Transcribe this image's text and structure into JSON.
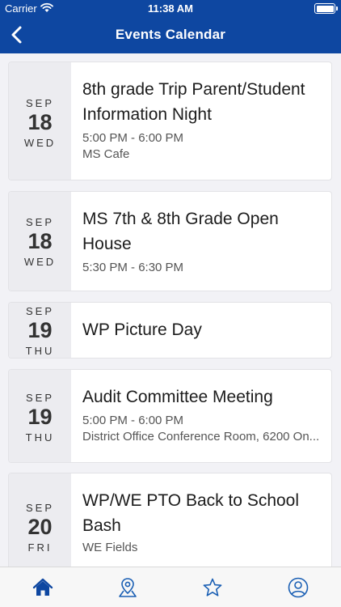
{
  "status": {
    "carrier": "Carrier",
    "time": "11:38 AM"
  },
  "header": {
    "title": "Events Calendar"
  },
  "events": [
    {
      "month": "SEP",
      "day": "18",
      "weekday": "WED",
      "title": "8th grade Trip Parent/Student Information Night",
      "time": "5:00 PM - 6:00 PM",
      "location": "MS Cafe"
    },
    {
      "month": "SEP",
      "day": "18",
      "weekday": "WED",
      "title": "MS 7th & 8th Grade Open House",
      "time": "5:30 PM - 6:30 PM",
      "location": ""
    },
    {
      "month": "SEP",
      "day": "19",
      "weekday": "THU",
      "title": "WP Picture Day",
      "time": "",
      "location": ""
    },
    {
      "month": "SEP",
      "day": "19",
      "weekday": "THU",
      "title": "Audit Committee Meeting",
      "time": "5:00 PM - 6:00 PM",
      "location": "District Office Conference Room, 6200 On..."
    },
    {
      "month": "SEP",
      "day": "20",
      "weekday": "FRI",
      "title": "WP/WE PTO Back to School Bash",
      "time": "",
      "location": "WE Fields"
    }
  ],
  "tabs": [
    {
      "icon": "home-icon",
      "active": true
    },
    {
      "icon": "map-pin-icon",
      "active": false
    },
    {
      "icon": "star-icon",
      "active": false
    },
    {
      "icon": "profile-icon",
      "active": false
    }
  ],
  "colors": {
    "header": "#0e47a1",
    "active_tab": "#0e47a1",
    "inactive_tab": "#1a5fb4",
    "date_panel": "#ececf0"
  }
}
